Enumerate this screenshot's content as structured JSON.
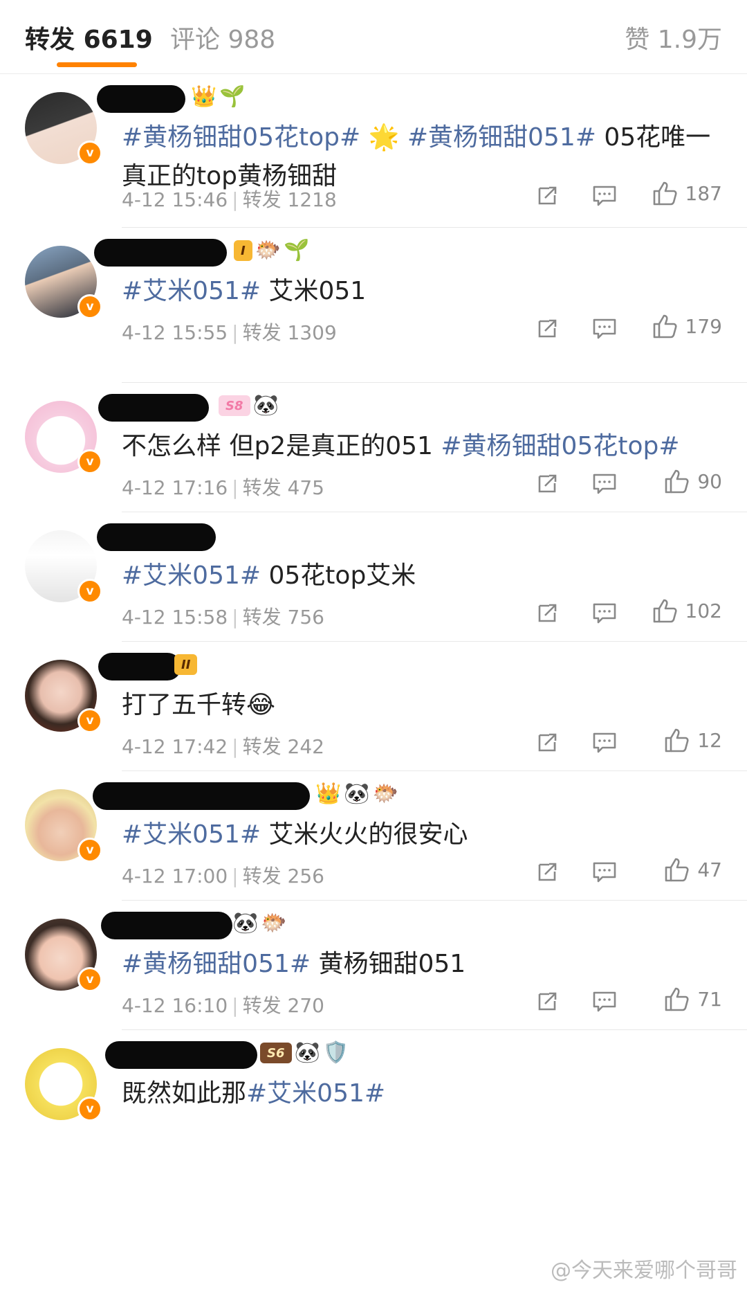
{
  "tabs": {
    "repost": {
      "label": "转发",
      "count": "6619"
    },
    "comment": {
      "label": "评论",
      "count": "988"
    },
    "like": {
      "label": "赞",
      "count": "1.9万"
    }
  },
  "colors": {
    "accent": "#ff8200",
    "topic": "#4e6b9f",
    "verified": "#ff8a00"
  },
  "items": [
    {
      "content": [
        {
          "t": "tag",
          "v": "#黄杨钿甜05花top#"
        },
        {
          "t": "text",
          "v": " 🌟 "
        },
        {
          "t": "tag",
          "v": "#黄杨钿甜051#"
        },
        {
          "t": "text",
          "v": " 05花唯一真正的top黄杨钿甜"
        }
      ],
      "time": "4-12 15:46",
      "repost_label": "转发",
      "repost_count": "1218",
      "likes": "187",
      "badges": [
        "crown-icon",
        "sprout-icon"
      ]
    },
    {
      "content": [
        {
          "t": "tag",
          "v": "#艾米051#"
        },
        {
          "t": "text",
          "v": " 艾米051"
        }
      ],
      "time": "4-12 15:55",
      "repost_label": "转发",
      "repost_count": "1309",
      "likes": "179",
      "level": "I",
      "badges": [
        "fish-icon",
        "sprout-icon"
      ]
    },
    {
      "content": [
        {
          "t": "text",
          "v": "不怎么样 但p2是真正的051 "
        },
        {
          "t": "tag",
          "v": "#黄杨钿甜05花top#"
        }
      ],
      "time": "4-12 17:16",
      "repost_label": "转发",
      "repost_count": "475",
      "likes": "90",
      "level": "S8",
      "badges": [
        "panda-icon"
      ]
    },
    {
      "content": [
        {
          "t": "tag",
          "v": "#艾米051#"
        },
        {
          "t": "text",
          "v": " 05花top艾米"
        }
      ],
      "time": "4-12 15:58",
      "repost_label": "转发",
      "repost_count": "756",
      "likes": "102",
      "badges": []
    },
    {
      "content": [
        {
          "t": "text",
          "v": "打了五千转😂"
        }
      ],
      "time": "4-12 17:42",
      "repost_label": "转发",
      "repost_count": "242",
      "likes": "12",
      "level": "II",
      "badges": []
    },
    {
      "content": [
        {
          "t": "tag",
          "v": "#艾米051#"
        },
        {
          "t": "text",
          "v": " 艾米火火的很安心"
        }
      ],
      "time": "4-12 17:00",
      "repost_label": "转发",
      "repost_count": "256",
      "likes": "47",
      "badges": [
        "crown-icon",
        "panda-icon",
        "fish-icon"
      ]
    },
    {
      "content": [
        {
          "t": "tag",
          "v": "#黄杨钿甜051#"
        },
        {
          "t": "text",
          "v": " 黄杨钿甜051"
        }
      ],
      "time": "4-12 16:10",
      "repost_label": "转发",
      "repost_count": "270",
      "likes": "71",
      "badges": [
        "panda-icon",
        "fish-icon"
      ]
    },
    {
      "content": [
        {
          "t": "text",
          "v": "既然如此那"
        },
        {
          "t": "tag",
          "v": "#艾米051#"
        }
      ],
      "level": "S6",
      "badges": [
        "panda-icon",
        "shield-icon"
      ]
    }
  ],
  "watermark": "@今天来爱哪个哥哥"
}
